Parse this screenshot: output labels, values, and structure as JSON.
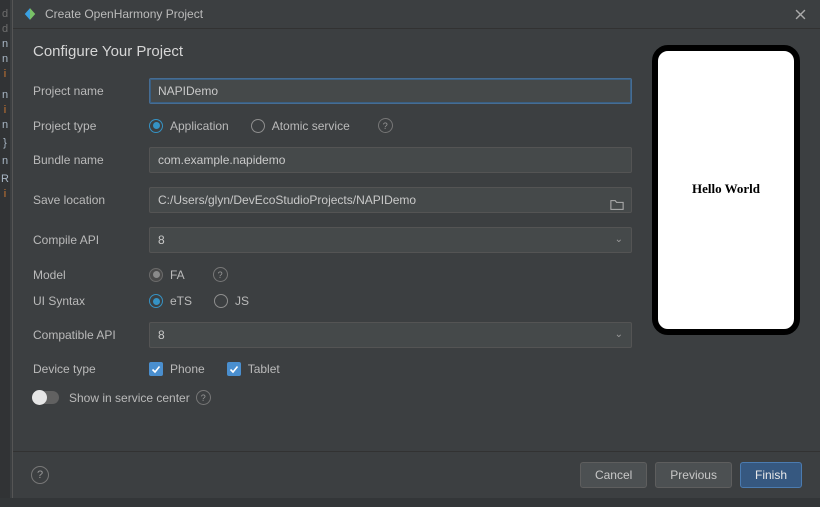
{
  "window": {
    "title": "Create OpenHarmony Project"
  },
  "heading": "Configure Your Project",
  "form": {
    "project_name_label": "Project name",
    "project_name_value": "NAPIDemo",
    "project_type_label": "Project type",
    "project_type_options": {
      "application": "Application",
      "atomic": "Atomic service"
    },
    "bundle_label": "Bundle name",
    "bundle_value": "com.example.napidemo",
    "save_label": "Save location",
    "save_value": "C:/Users/glyn/DevEcoStudioProjects/NAPIDemo",
    "compile_api_label": "Compile API",
    "compile_api_value": "8",
    "model_label": "Model",
    "model_value": "FA",
    "ui_syntax_label": "UI Syntax",
    "ui_syntax_options": {
      "ets": "eTS",
      "js": "JS"
    },
    "compat_api_label": "Compatible API",
    "compat_api_value": "8",
    "device_type_label": "Device type",
    "device_type_options": {
      "phone": "Phone",
      "tablet": "Tablet"
    },
    "show_in_service_center": "Show in service center"
  },
  "preview": {
    "text": "Hello World"
  },
  "buttons": {
    "cancel": "Cancel",
    "previous": "Previous",
    "finish": "Finish"
  }
}
